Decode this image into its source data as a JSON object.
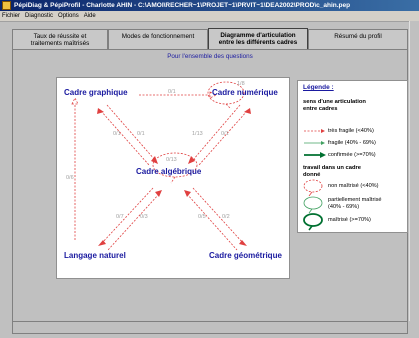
{
  "window": {
    "title": "PépiDiag & PépiProfil - Charlotte AHIN - C:\\AMOI\\RECHER~1\\PROJET~1\\PRVIT~1\\DEA2002\\PROD\\c_ahin.pep"
  },
  "menu": [
    "Fichier",
    "Diagnostic",
    "Options",
    "Aide"
  ],
  "tabs": [
    {
      "label_1": "Taux de réussite et",
      "label_2": "traitements maîtrisés",
      "active": false
    },
    {
      "label_1": "Modes de fonctionnement",
      "label_2": "",
      "active": false
    },
    {
      "label_1": "Diagramme d'articulation",
      "label_2": "entre les différents cadres",
      "active": true
    },
    {
      "label_1": "Résumé du profil",
      "label_2": "",
      "active": false
    }
  ],
  "subtitle": "Pour l'ensemble des questions",
  "diagram": {
    "cadres": {
      "graphique": "Cadre graphique",
      "numerique": "Cadre numérique",
      "algebrique": "Cadre algébrique",
      "naturel": "Langage naturel",
      "geometrique": "Cadre géométrique"
    },
    "scores": {
      "top_edge": "0/1",
      "num_self": "1/8",
      "alg_self": "0/13",
      "left_edge": "0/6",
      "g_a_1": "0/1",
      "g_a_2": "0/1",
      "n_a_1": "1/13",
      "n_a_2": "0/1",
      "l_a_1": "0/7",
      "l_a_2": "0/3",
      "ge_a_1": "0/5",
      "ge_a_2": "0/2"
    }
  },
  "legend": {
    "title": "Légende :",
    "section1": "sens d'une articulation entre cadres",
    "section1_l1": "sens d'une articulation",
    "section1_l2": "entre cadres",
    "arrows": [
      "très fragile (<40%)",
      "fragile (40% - 69%)",
      "confirmée (>=70%)"
    ],
    "section2_l1": "travail dans un cadre",
    "section2_l2": "donné",
    "bubbles": [
      "non maîtrisé (<40%)",
      "partiellement maîtrisé",
      "(40% - 69%)",
      "maîtrisé (>=70%)"
    ]
  },
  "colors": {
    "label_blue": "#1a1aa0",
    "very_fragile": "#e04040",
    "fragile": "#40a060",
    "confirmed": "#007030"
  }
}
